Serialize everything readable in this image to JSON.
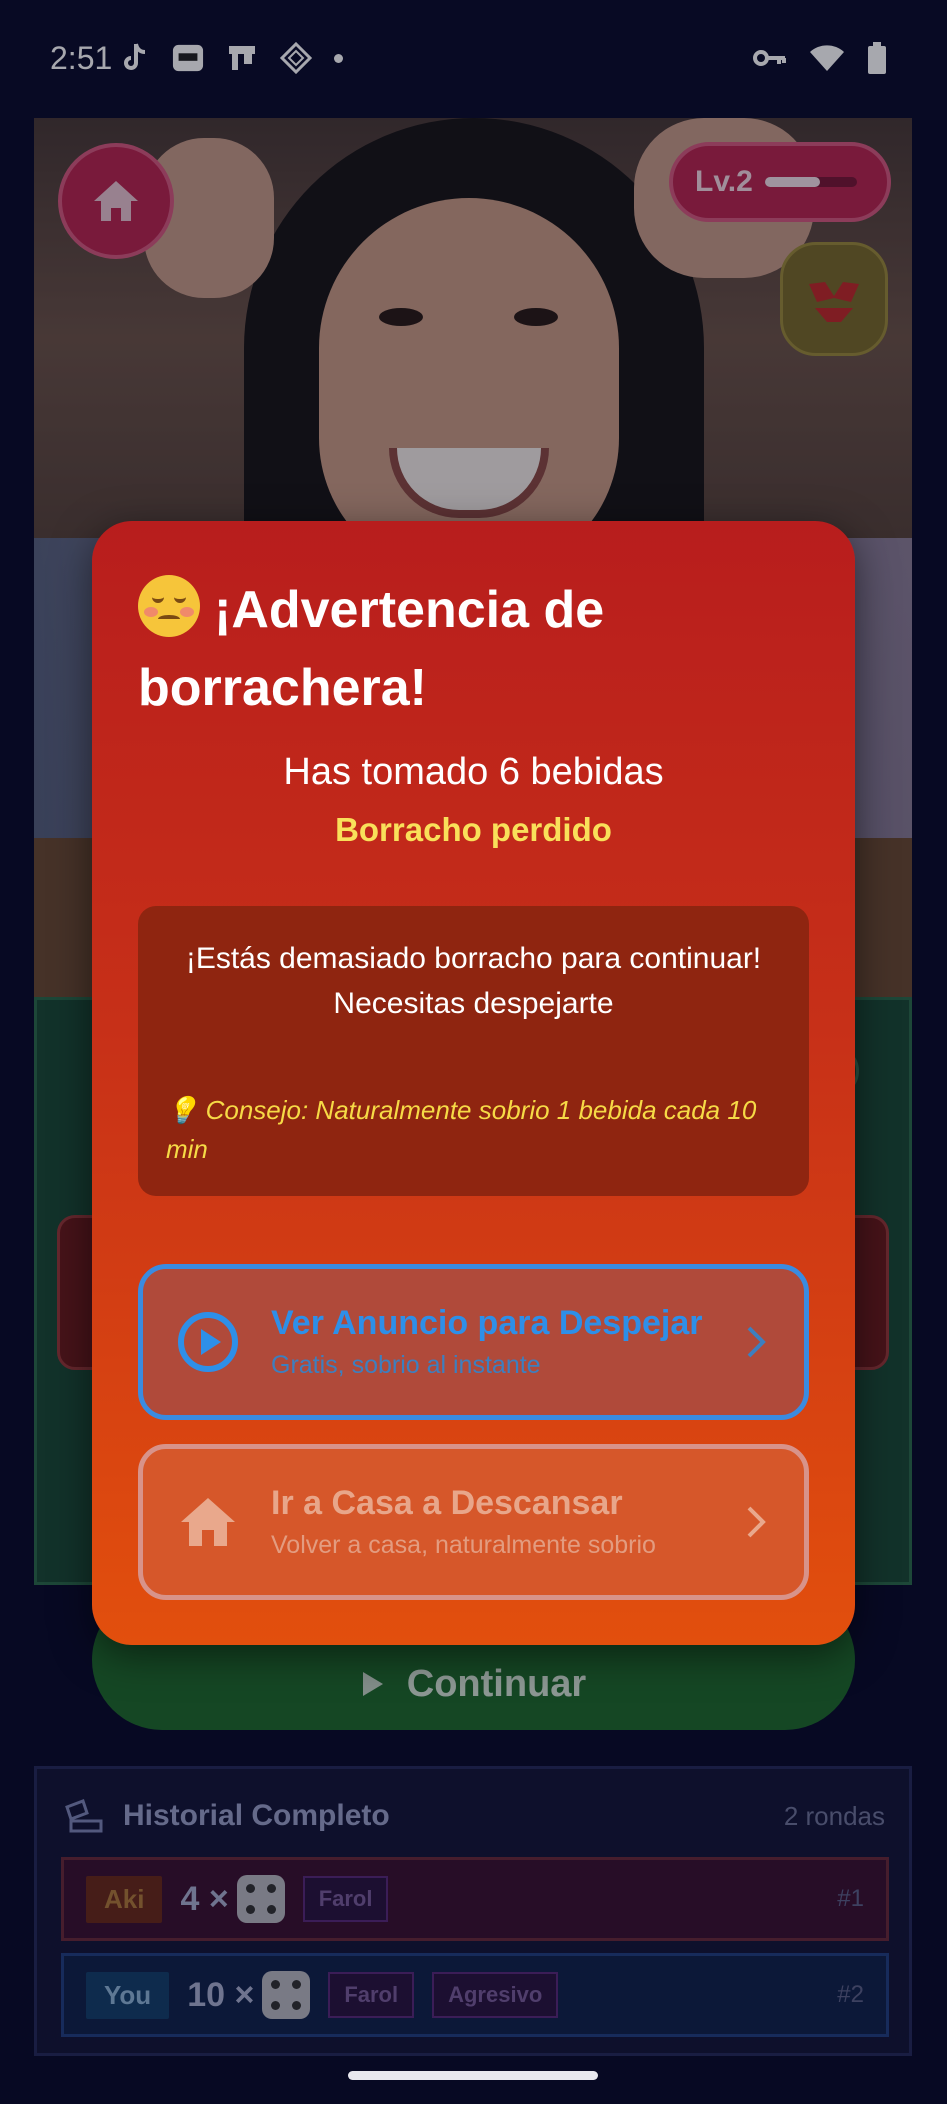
{
  "status_bar": {
    "time": "2:51"
  },
  "header": {
    "level_label": "Lv.2",
    "level_progress": 0.6
  },
  "continue_button": {
    "label": "Continuar"
  },
  "history": {
    "title": "Historial Completo",
    "count": "2 rondas",
    "rows": [
      {
        "player": "Aki",
        "quantity": "4 ×",
        "tags": [
          "Farol"
        ],
        "round": "#1"
      },
      {
        "player": "You",
        "quantity": "10 ×",
        "tags": [
          "Farol",
          "Agresivo"
        ],
        "round": "#2"
      }
    ]
  },
  "modal": {
    "title": "¡Advertencia de borrachera!",
    "drinks_text": "Has tomado 6 bebidas",
    "status_text": "Borracho perdido",
    "warning_line1": "¡Estás demasiado borracho para continuar!",
    "warning_line2": "Necesitas despejarte",
    "tip": "💡 Consejo: Naturalmente sobrio 1 bebida cada 10 min",
    "ad_button": {
      "title": "Ver Anuncio para Despejar",
      "subtitle": "Gratis, sobrio al instante"
    },
    "home_button": {
      "title": "Ir a Casa a Descansar",
      "subtitle": "Volver a casa, naturalmente sobrio"
    }
  },
  "colors": {
    "modal_top": "#b81d1d",
    "modal_bottom": "#e24f0d",
    "ad_border": "#3a8be0",
    "status_yellow": "#f9e05a"
  }
}
